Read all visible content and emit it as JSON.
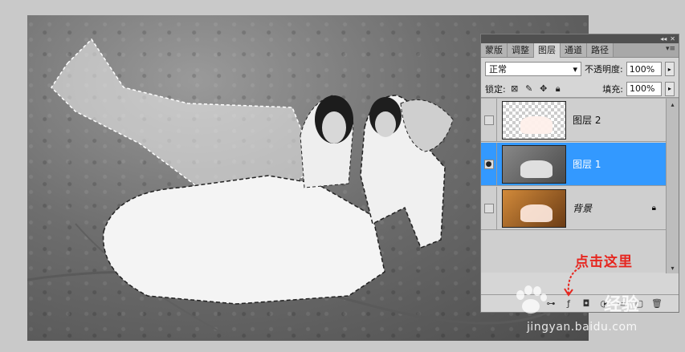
{
  "panel": {
    "tabs": [
      {
        "label": "蒙版",
        "active": false
      },
      {
        "label": "调整",
        "active": false
      },
      {
        "label": "图层",
        "active": true
      },
      {
        "label": "通道",
        "active": false
      },
      {
        "label": "路径",
        "active": false
      }
    ],
    "blend_mode": "正常",
    "opacity_label": "不透明度:",
    "opacity_value": "100%",
    "lock_label": "锁定:",
    "fill_label": "填充:",
    "fill_value": "100%",
    "layers": [
      {
        "name": "图层 2",
        "visible": false,
        "selected": false,
        "thumb": "checker"
      },
      {
        "name": "图层 1",
        "visible": true,
        "selected": true,
        "thumb": "gray"
      },
      {
        "name": "背景",
        "visible": false,
        "selected": false,
        "thumb": "warm",
        "locked": true
      }
    ],
    "bottom_icons": [
      "link-icon",
      "fx-icon",
      "mask-icon",
      "adjustment-icon",
      "folder-icon",
      "new-layer-icon",
      "trash-icon"
    ]
  },
  "annotation": {
    "text": "点击这里",
    "color": "#e6261f"
  },
  "watermark": {
    "brand": "经验",
    "url": "jingyan.baidu.com"
  },
  "colors": {
    "selection": "#3399ff",
    "panel_bg": "#d6d6d6",
    "canvas_bg": "#6e6e6e"
  }
}
